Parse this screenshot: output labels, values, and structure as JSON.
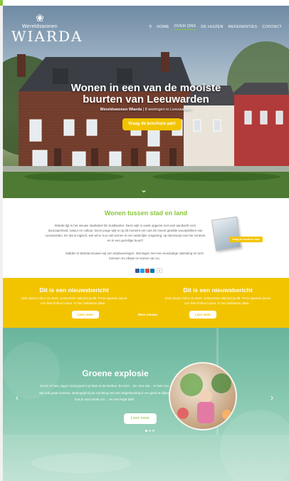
{
  "brand": {
    "tagline": "Wereldswonen",
    "name": "WIARDA"
  },
  "nav": {
    "items": [
      "HOME",
      "OVER ONS",
      "DE HUIZEN",
      "REFERENTIES",
      "CONTACT"
    ],
    "active_index": 1
  },
  "hero": {
    "title_line1": "Wonen in een van de mooiste",
    "title_line2": "buurten van Leeuwarden",
    "subtitle_bold": "Wereldswonen Wiarda",
    "subtitle_rest": " | 8 woningen in Leeuwarden",
    "cta": "Vraag de brochure aan!"
  },
  "intro": {
    "title": "Wonen tussen stad en land",
    "paragraph1": "Wiarda ligt in het nieuwe stadsdeel De Zuidlanden. Deze wijk is uniek opgezet met veel aandacht voor duurzaamheid, natuur en cultuur. Deze jonge wijk is op dit moment een van de meest gewilde woonplekken van Leeuwarden. En dat is logisch, wie wil er nou niet wonen in een waterrijke omgeving, op steenworp van het centrum en in een gezellige buurt?",
    "paragraph2": "Midden in Wiarda bouwen wij een stadswoningen. Woningen met een eenduidige uitstraling en toch mensen om elkaar en wonen van nu.",
    "brochure_label": "Vraag de brochure aan!",
    "share_count": "0"
  },
  "news": {
    "items": [
      {
        "title": "Dit is een nieuwsbericht",
        "text": "orem ipsum dolor sit amet, consectetur adipiscing elit. Proin egestas ipsum non felis finibus luctus. In hac habitasse plate...",
        "button": "Lees meer"
      },
      {
        "title": "Dit is een nieuwsbericht",
        "text": "orem ipsum dolor sit amet, consectetur adipiscing elit. Proin egestas ipsum non felis finibus luctus. In hac habitasse plate...",
        "button": "Lees meer"
      }
    ],
    "more_link": "Meer nieuws"
  },
  "slider": {
    "title": "Groene explosie",
    "text": "Groen in huis, lag je nooit goed in je kam in de keuken. En toch... En voor wie... In huis zou wel ook graan kunnen. Belangrijk bij de inrichting van een stapelwoning is om goed te kijken hoe je met ruimte om ... en een hoge tafel",
    "button": "Lees meer",
    "slides": 3,
    "active_slide": 0
  },
  "colors": {
    "green": "#8cc63f",
    "yellow": "#f2c400",
    "teal": "#6ab49c"
  }
}
